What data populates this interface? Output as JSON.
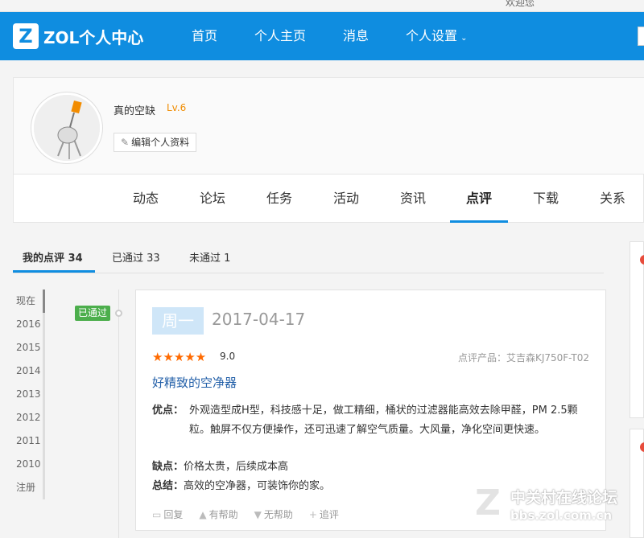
{
  "topbar": {
    "right_text": "欢迎您"
  },
  "header": {
    "logo_mark": "Z",
    "logo_text": "ZOL个人中心",
    "nav": [
      "首页",
      "个人主页",
      "消息",
      "个人设置"
    ],
    "settings_chevron": "⌄"
  },
  "profile": {
    "username": "真的空缺",
    "level": "Lv.6",
    "edit_label": "编辑个人资料"
  },
  "tabs": [
    "动态",
    "论坛",
    "任务",
    "活动",
    "资讯",
    "点评",
    "下载",
    "关系"
  ],
  "subtabs": {
    "mine": "我的点评 34",
    "passed": "已通过 33",
    "failed": "未通过 1"
  },
  "years": [
    "现在",
    "2016",
    "2015",
    "2014",
    "2013",
    "2012",
    "2011",
    "2010",
    "注册"
  ],
  "review": {
    "status": "已通过",
    "weekday": "周一",
    "date": "2017-04-17",
    "stars": "★★★★★",
    "score": "9.0",
    "product": "点评产品：艾吉森KJ750F-T02",
    "title": "好精致的空净器",
    "pros_label": "优点：",
    "pros": "外观造型成H型，科技感十足，做工精细，桶状的过滤器能高效去除甲醛，PM 2.5颗粒。触屏不仅方便操作，还可迅速了解空气质量。大风量，净化空间更快速。",
    "cons_label": "缺点：",
    "cons": "价格太贵，后续成本高",
    "summary_label": "总结：",
    "summary": "高效的空净器，可装饰你的家。",
    "actions": [
      "回复",
      "有帮助",
      "无帮助",
      "追评"
    ]
  },
  "watermark": {
    "cn": "中关村在线论坛",
    "url": "bbs.zol.com.cn"
  },
  "colors": {
    "brand": "#0f8de0",
    "star": "#ff6a00",
    "passed": "#4cae4c"
  }
}
